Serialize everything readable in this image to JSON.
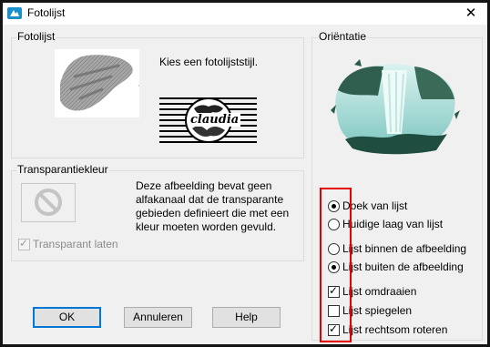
{
  "window": {
    "title": "Fotolijst",
    "close_glyph": "✕",
    "accent": "#0078d7"
  },
  "frame_group": {
    "label": "Fotolijst",
    "instruction": "Kies een fotolijststijl.",
    "style_text": "claudia"
  },
  "transparency_group": {
    "label": "Transparantiekleur",
    "description": [
      "Deze afbeelding bevat geen",
      "alfakanaal dat de transparante",
      "gebieden definieert die met een",
      "kleur moeten worden gevuld."
    ],
    "checkbox_label": "Transparant laten",
    "checkbox_checked": true,
    "checkbox_disabled": true
  },
  "orientation_group": {
    "label": "Oriëntatie",
    "apply_to": [
      {
        "label": "Doek van lijst",
        "selected": true
      },
      {
        "label": "Huidige laag van lijst",
        "selected": false
      }
    ],
    "placement": [
      {
        "label": "Lijst binnen de afbeelding",
        "selected": false
      },
      {
        "label": "Lijst buiten de afbeelding",
        "selected": true
      }
    ],
    "options": [
      {
        "label": "Lijst omdraaien",
        "checked": true
      },
      {
        "label": "Lijst spiegelen",
        "checked": false
      },
      {
        "label": "Lijst rechtsom roteren",
        "checked": true
      }
    ]
  },
  "buttons": {
    "ok": "OK",
    "cancel": "Annuleren",
    "help": "Help"
  },
  "annotation_color": "#e60000"
}
